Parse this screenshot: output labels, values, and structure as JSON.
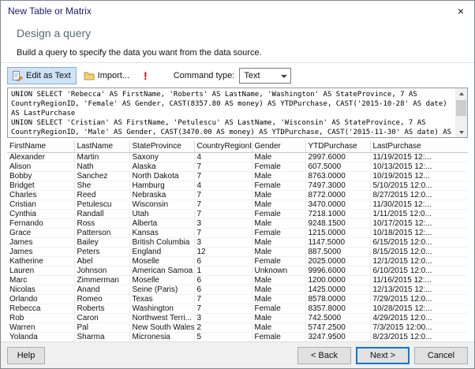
{
  "window": {
    "title": "New Table or Matrix",
    "close_glyph": "×"
  },
  "header": {
    "title": "Design a query",
    "instruction": "Build a query to specify the data you want from the data source."
  },
  "toolbar": {
    "edit_as_text": "Edit as Text",
    "import": "Import...",
    "run_glyph": "!",
    "command_type_label": "Command type:",
    "command_type_value": "Text"
  },
  "query": {
    "sql": "UNION SELECT 'Rebecca' AS FirstName, 'Roberts' AS LastName, 'Washington' AS StateProvince, 7 AS\nCountryRegionID, 'Female' AS Gender, CAST(8357.80 AS money) AS YTDPurchase, CAST('2015-10-28' AS date)\nAS LastPurchase\nUNION SELECT 'Cristian' AS FirstName, 'Petulescu' AS LastName, 'Wisconsin' AS StateProvince, 7 AS\nCountryRegionID, 'Male' AS Gender, CAST(3470.00 AS money) AS YTDPurchase, CAST('2015-11-30' AS date) AS"
  },
  "grid": {
    "columns": [
      "FirstName",
      "LastName",
      "StateProvince",
      "CountryRegionID",
      "Gender",
      "YTDPurchase",
      "LastPurchase"
    ],
    "rows": [
      [
        "Alexander",
        "Martin",
        "Saxony",
        "4",
        "Male",
        "2997.6000",
        "11/19/2015 12:..."
      ],
      [
        "Alison",
        "Nath",
        "Alaska",
        "7",
        "Female",
        "607.5000",
        "10/13/2015 12:..."
      ],
      [
        "Bobby",
        "Sanchez",
        "North Dakota",
        "7",
        "Male",
        "8763.0000",
        "10/19/2015 12..."
      ],
      [
        "Bridget",
        "She",
        "Hamburg",
        "4",
        "Female",
        "7497.3000",
        "5/10/2015 12:0..."
      ],
      [
        "Charles",
        "Reed",
        "Nebraska",
        "7",
        "Male",
        "8772.0000",
        "8/27/2015 12:0..."
      ],
      [
        "Cristian",
        "Petulescu",
        "Wisconsin",
        "7",
        "Male",
        "3470.0000",
        "11/30/2015 12:..."
      ],
      [
        "Cynthia",
        "Randall",
        "Utah",
        "7",
        "Female",
        "7218.1000",
        "1/11/2015 12:0..."
      ],
      [
        "Fernando",
        "Ross",
        "Alberta",
        "3",
        "Male",
        "9248.1500",
        "10/17/2015 12:..."
      ],
      [
        "Grace",
        "Patterson",
        "Kansas",
        "7",
        "Female",
        "1215.0000",
        "10/18/2015 12:..."
      ],
      [
        "James",
        "Bailey",
        "British Columbia",
        "3",
        "Male",
        "1147.5000",
        "6/15/2015 12:0..."
      ],
      [
        "James",
        "Peters",
        "England",
        "12",
        "Male",
        "887.5000",
        "8/15/2015 12:0..."
      ],
      [
        "Katherine",
        "Abel",
        "Moselle",
        "6",
        "Female",
        "2025.0000",
        "12/1/2015 12:0..."
      ],
      [
        "Lauren",
        "Johnson",
        "American Samoa",
        "1",
        "Unknown",
        "9996.6000",
        "6/10/2015 12:0..."
      ],
      [
        "Marc",
        "Zimmerman",
        "Moselle",
        "6",
        "Male",
        "1200.0000",
        "11/16/2015 12:..."
      ],
      [
        "Nicolas",
        "Anand",
        "Seine (Paris)",
        "6",
        "Male",
        "1425.0000",
        "12/13/2015 12:..."
      ],
      [
        "Orlando",
        "Romeo",
        "Texas",
        "7",
        "Male",
        "8578.0000",
        "7/29/2015 12:0..."
      ],
      [
        "Rebecca",
        "Roberts",
        "Washington",
        "7",
        "Female",
        "8357.8000",
        "10/28/2015 12:..."
      ],
      [
        "Rob",
        "Caron",
        "Northwest Terri...",
        "3",
        "Male",
        "742.5000",
        "4/29/2015 12:0..."
      ],
      [
        "Warren",
        "Pal",
        "New South Wales",
        "2",
        "Male",
        "5747.2500",
        "7/3/2015 12:00..."
      ],
      [
        "Yolanda",
        "Sharma",
        "Micronesia",
        "5",
        "Female",
        "3247.9500",
        "8/23/2015 12:0..."
      ]
    ]
  },
  "footer": {
    "help": "Help",
    "back": "< Back",
    "next": "Next >",
    "cancel": "Cancel"
  },
  "colors": {
    "accent": "#0078d7",
    "run_icon_red": "#d00000",
    "toolbar_selected_bg": "#cfe3f7"
  }
}
